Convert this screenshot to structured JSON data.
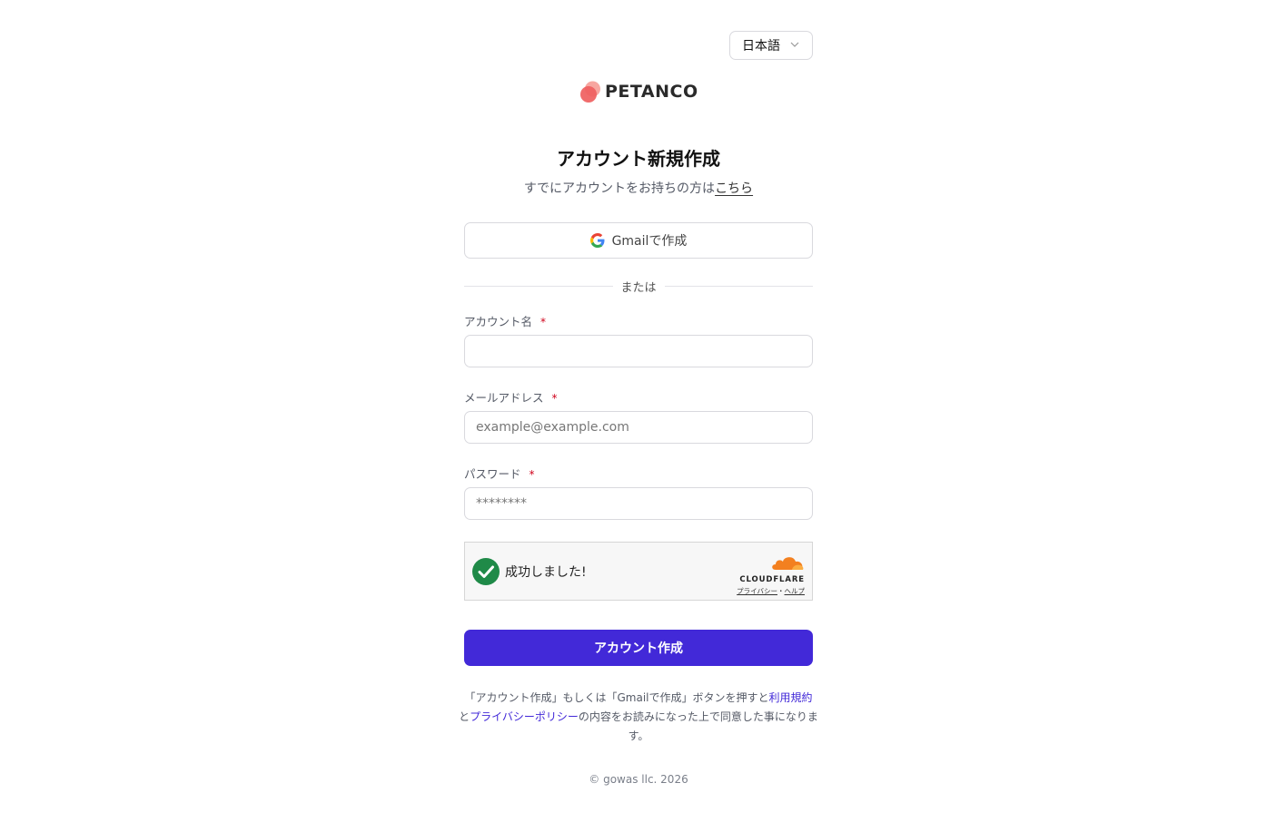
{
  "language_select": {
    "value": "日本語"
  },
  "brand": {
    "name": "PETANCO",
    "colors": {
      "primary": "#ef5f5f",
      "light": "#f7a6a0"
    }
  },
  "heading": {
    "title": "アカウント新規作成",
    "subtitle_prefix": "すでにアカウントをお持ちの方は",
    "login_link": "こちら"
  },
  "google_button": {
    "label": "Gmailで作成",
    "icon": "google-g-icon"
  },
  "divider": {
    "text": "または"
  },
  "form": {
    "account_name": {
      "label": "アカウント名",
      "required_mark": "*",
      "value": "",
      "placeholder": ""
    },
    "email": {
      "label": "メールアドレス",
      "required_mark": "*",
      "value": "",
      "placeholder": "example@example.com"
    },
    "password": {
      "label": "パスワード",
      "required_mark": "*",
      "value": "",
      "placeholder": "********"
    }
  },
  "captcha": {
    "status_text": "成功しました!",
    "provider": "CLOUDFLARE",
    "privacy_link": "プライバシー",
    "separator": "・",
    "help_link": "ヘルプ",
    "colors": {
      "success": "#1f8a48",
      "cloud": "#f38020"
    }
  },
  "submit_button": {
    "label": "アカウント作成",
    "color": "#4229d8"
  },
  "terms": {
    "part1": "「アカウント作成」もしくは「Gmailで作成」ボタンを押すと",
    "terms_link": "利用規約",
    "part2": "と",
    "privacy_link": "プライバシーポリシー",
    "part3": "の内容をお読みになった上で同意した事になります。"
  },
  "footer": {
    "copyright": "© gowas llc. 2026"
  }
}
